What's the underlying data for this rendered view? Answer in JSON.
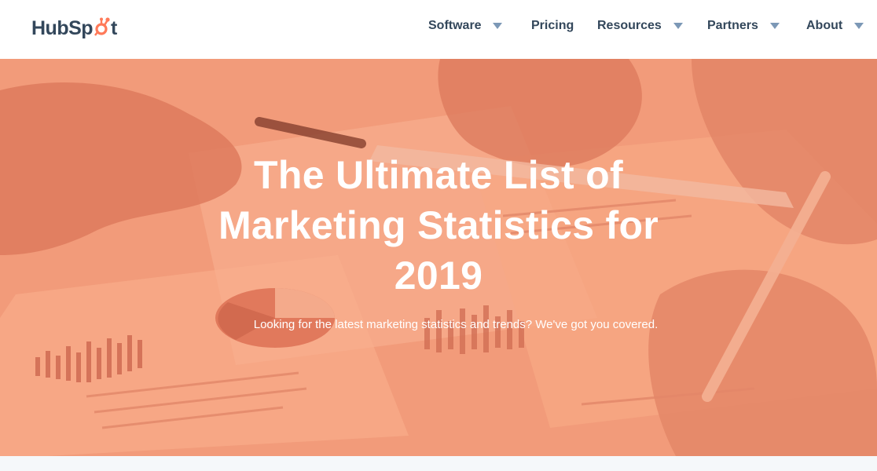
{
  "brand": {
    "logo_text_before": "HubSp",
    "logo_text_after": "t",
    "colors": {
      "orange": "#ff7a59",
      "navy": "#33475b",
      "caret": "#7c98b6",
      "hero_overlay": "#f5a27f"
    }
  },
  "nav": {
    "items": [
      {
        "label": "Software",
        "icon": "caret-down-icon"
      },
      {
        "label": "Pricing"
      },
      {
        "label": "Resources",
        "icon": "caret-down-icon"
      },
      {
        "label": "Partners",
        "icon": "caret-down-icon"
      },
      {
        "label": "About",
        "icon": "caret-down-icon"
      }
    ]
  },
  "hero": {
    "title": "The Ultimate List of Marketing Statistics for 2019",
    "subtitle": "Looking for the latest marketing statistics and trends? We've got you covered."
  }
}
